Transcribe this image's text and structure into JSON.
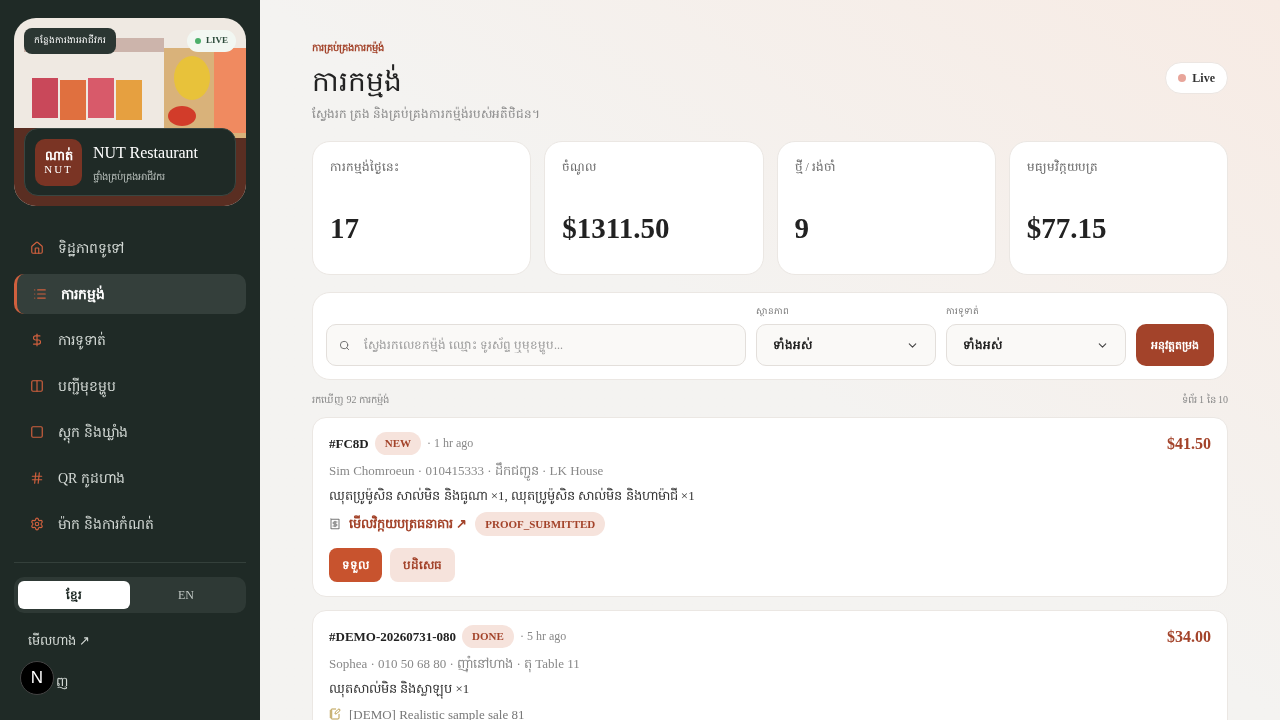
{
  "sidebar": {
    "workspace_badge": "កន្លែងការងារអាជីវករ",
    "live_badge": "LIVE",
    "brand": {
      "logo_line1": "ណាត់",
      "logo_line2": "NUT",
      "name": "NUT Restaurant",
      "subtitle": "ផ្ទាំងគ្រប់គ្រងអាជីវករ"
    },
    "items": [
      {
        "label": "ទិដ្ឋភាពទូទៅ",
        "kind": "home",
        "selected": false
      },
      {
        "label": "ការកម្មង់",
        "kind": "list",
        "selected": true
      },
      {
        "label": "ការទូទាត់",
        "kind": "dollar",
        "selected": false
      },
      {
        "label": "បញ្ជីមុខម្ហូប",
        "kind": "columns",
        "selected": false
      },
      {
        "label": "ស្តុក និងឃ្លាំង",
        "kind": "square",
        "selected": false
      },
      {
        "label": "QR កូដហាង",
        "kind": "hash",
        "selected": false
      },
      {
        "label": "ម៉ាក និងការកំណត់",
        "kind": "settings",
        "selected": false
      }
    ],
    "languages": [
      {
        "label": "ខ្មែរ",
        "selected": true
      },
      {
        "label": "EN",
        "selected": false
      }
    ],
    "view_store": "មើលហាង ↗",
    "logout": "ញ",
    "dev_badge": "N"
  },
  "header": {
    "eyebrow": "ការគ្រប់គ្រងការកម្ម៉ង់",
    "title": "ការកម្មង់",
    "subtitle": "ស្វែងរក ត្រង និងគ្រប់គ្រងការកម្ម៉ង់របស់អតិថិជន។",
    "live": "Live"
  },
  "stats": [
    {
      "label": "ការកម្មង់ថ្ងៃនេះ",
      "value": "17"
    },
    {
      "label": "ចំណូល",
      "value": "$1311.50"
    },
    {
      "label": "ថ្មី / រង់ចាំ",
      "value": "9"
    },
    {
      "label": "មធ្យមវិក្កយបត្រ",
      "value": "$77.15"
    }
  ],
  "filters": {
    "search_placeholder": "ស្វែងរកលេខកម្ម៉ង់ ឈ្មោះ ទូរស័ព្ទ ឬមុខម្ហូប...",
    "status_label": "ស្ថានភាព",
    "status_value": "ទាំងអស់",
    "payment_label": "ការទូទាត់",
    "payment_value": "ទាំងអស់",
    "apply": "អនុវត្តតម្រង"
  },
  "results": {
    "count": "រកឃើញ 92 ការកម្ម៉ង់",
    "page": "ទំព័រ 1 នៃ 10"
  },
  "orders": [
    {
      "id": "#FC8D",
      "status": "NEW",
      "time": "· 1 hr ago",
      "meta": "Sim Chomroeun · 010415333 · ដឹកជញ្ជូន · LK House",
      "items": "ឈុតប្រូម៉ូសិន សាល់មិន និងធូណា ×1, ឈុតប្រូម៉ូសិន សាល់មិន និងហាម៉ាជី ×1",
      "total": "$41.50",
      "kind": "receipt",
      "proof_link": "មើលវិក្កយបត្រធនាគារ ↗",
      "payment_status": "PROOF_SUBMITTED",
      "actions": [
        "ទទួល",
        "បដិសេធ"
      ]
    },
    {
      "id": "#DEMO-20260731-080",
      "status": "DONE",
      "time": "· 5 hr ago",
      "meta": "Sophea · 010 50 68 80 · ញ៉ាំនៅហាង · តុ Table 11",
      "items": "ឈុតសាល់មិន និងស្លាឡុប ×1",
      "total": "$34.00",
      "kind": "note",
      "note": "[DEMO] Realistic sample sale 81"
    }
  ]
}
